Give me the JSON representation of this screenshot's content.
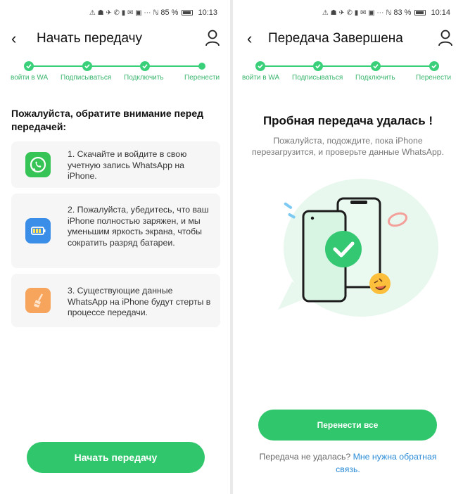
{
  "status_left": {
    "battery_pct": "85 %",
    "time": "10:13"
  },
  "status_right": {
    "battery_pct": "83 %",
    "time": "10:14"
  },
  "steps": [
    "войти в WA",
    "Подписываться",
    "Подключить",
    "Перенести"
  ],
  "screen1": {
    "title": "Начать передачу",
    "notice": "Пожалуйста, обратите внимание перед передачей:",
    "cards": [
      {
        "icon": "whatsapp-icon",
        "text": "1. Скачайте и войдите в свою учетную запись WhatsApp на iPhone."
      },
      {
        "icon": "battery-icon",
        "text": "2. Пожалуйста, убедитесь, что ваш iPhone полностью заряжен, и мы уменьшим яркость экрана, чтобы сократить разряд батареи."
      },
      {
        "icon": "broom-icon",
        "text": "3. Существующие данные WhatsApp на iPhone будут стерты в процессе передачи."
      }
    ],
    "button": "Начать передачу"
  },
  "screen2": {
    "title": "Передача Завершена",
    "heading": "Пробная передача удалась !",
    "subtitle": "Пожалуйста, подождите, пока iPhone перезагрузится, и проверьте данные WhatsApp.",
    "button": "Перенести все",
    "footer_text": "Передача не удалась? ",
    "footer_link": "Мне нужна обратная связь."
  },
  "colors": {
    "accent": "#2fc66c",
    "link": "#2a8bd6"
  }
}
